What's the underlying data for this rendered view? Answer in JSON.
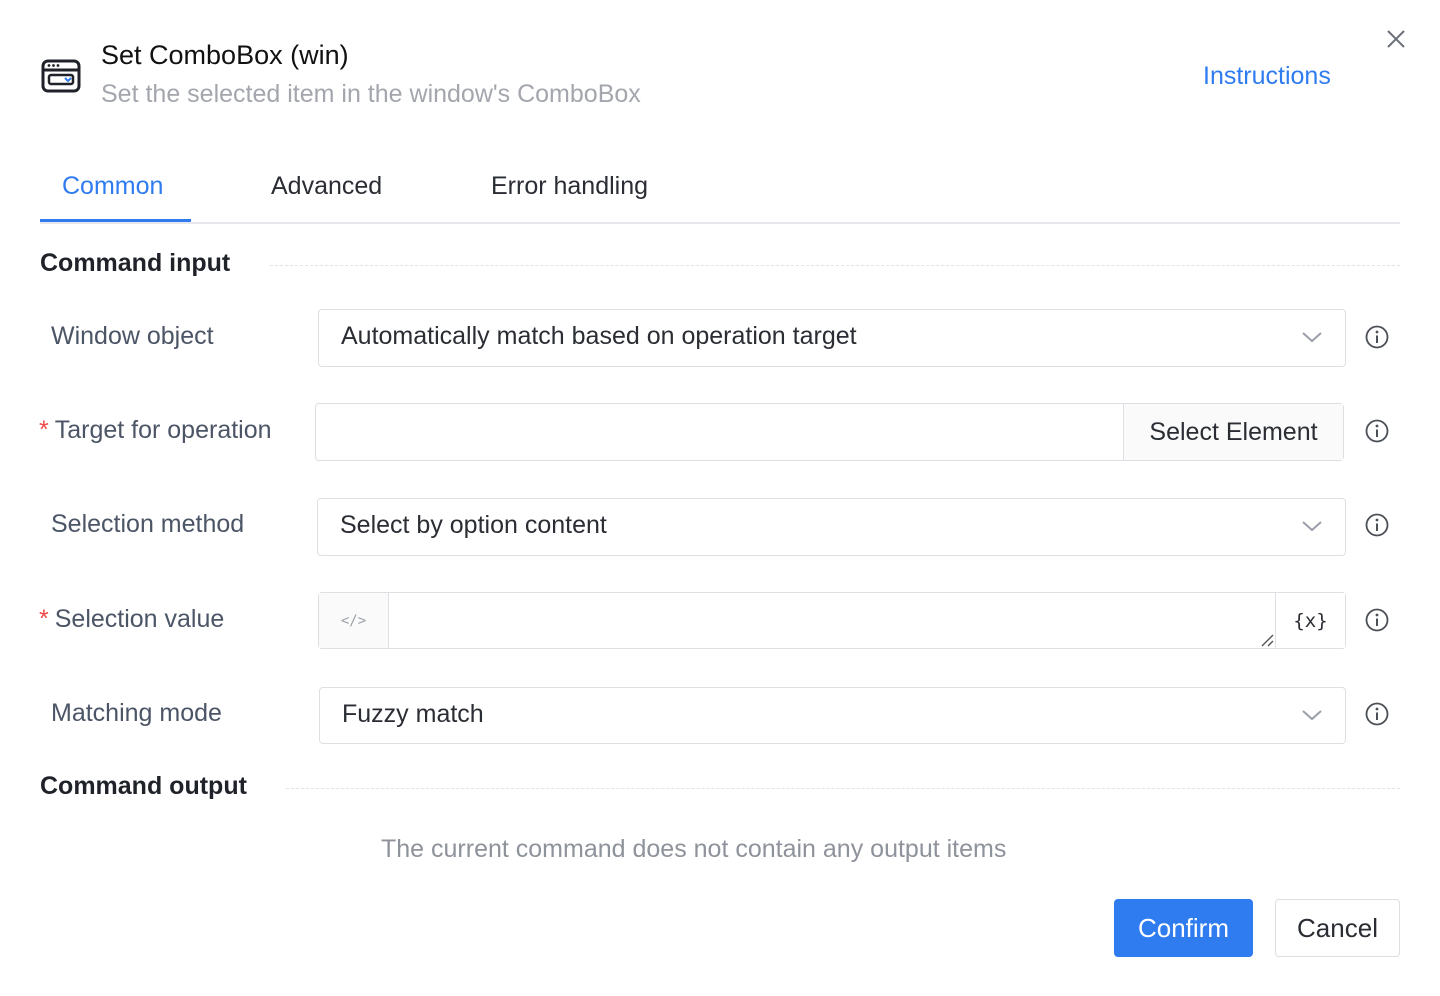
{
  "header": {
    "title": "Set ComboBox (win)",
    "subtitle": "Set the selected item in the window's ComboBox",
    "instructions_label": "Instructions",
    "icon": "window-combobox-icon"
  },
  "tabs": [
    {
      "label": "Common",
      "active": true
    },
    {
      "label": "Advanced",
      "active": false
    },
    {
      "label": "Error handling",
      "active": false
    }
  ],
  "sections": {
    "input_title": "Command input",
    "output_title": "Command output",
    "output_empty": "The current command does not contain any output items"
  },
  "fields": {
    "window_object": {
      "label": "Window object",
      "value": "Automatically match based on operation target"
    },
    "target": {
      "label": "Target for operation",
      "required": "*",
      "value": "",
      "button": "Select Element"
    },
    "selection_method": {
      "label": "Selection method",
      "value": "Select by option content"
    },
    "selection_value": {
      "label": "Selection value",
      "required": "*",
      "value": "",
      "code_icon": "</>",
      "var_icon": "{x}"
    },
    "matching_mode": {
      "label": "Matching mode",
      "value": "Fuzzy match"
    }
  },
  "footer": {
    "confirm_label": "Confirm",
    "cancel_label": "Cancel"
  },
  "colors": {
    "accent": "#2f7bf0",
    "required": "#f04a4a"
  }
}
